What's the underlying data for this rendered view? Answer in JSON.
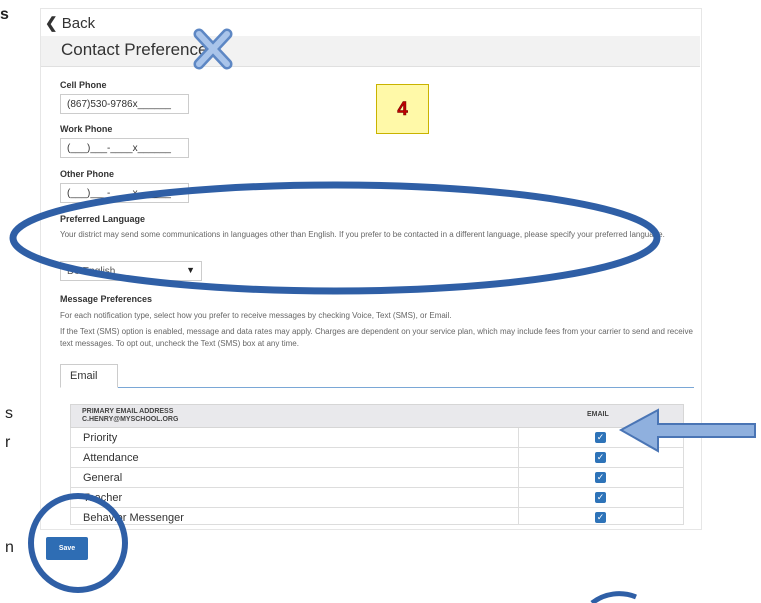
{
  "left_fragments": {
    "top": "s",
    "mid1": "s",
    "mid2": "r",
    "bottom": "n"
  },
  "nav": {
    "back_label": "Back",
    "back_icon": "chevron-left-icon"
  },
  "page": {
    "title": "Contact Preferences"
  },
  "fields": {
    "cell_phone": {
      "label": "Cell Phone",
      "value": "(867)530-9786x______"
    },
    "work_phone": {
      "label": "Work Phone",
      "value": "(___)___-____x______"
    },
    "other_phone": {
      "label": "Other Phone",
      "value": "(___)___-____x______"
    }
  },
  "preferred_language": {
    "label": "Preferred Language",
    "description": "Your district may send some communications in languages other than English. If you prefer to be contacted in a different language, please specify your preferred language.",
    "selected": "Do English"
  },
  "message_preferences": {
    "label": "Message Preferences",
    "intro": "For each notification type, select how you prefer to receive messages by checking Voice, Text (SMS), or Email.",
    "sms_note": "If the Text (SMS) option is enabled, message and data rates may apply. Charges are dependent on your service plan, which may include fees from your carrier to send and receive text messages. To opt out, uncheck the Text (SMS) box at any time."
  },
  "tabs": [
    {
      "label": "Email"
    }
  ],
  "table": {
    "header_primary": "PRIMARY EMAIL ADDRESS",
    "header_address": "C.HENRY@MYSCHOOL.ORG",
    "header_col": "EMAIL",
    "rows": [
      {
        "label": "Priority",
        "checked": true
      },
      {
        "label": "Attendance",
        "checked": true
      },
      {
        "label": "General",
        "checked": true
      },
      {
        "label": "Teacher",
        "checked": true
      },
      {
        "label": "Behavior Messenger",
        "checked": true
      }
    ]
  },
  "actions": {
    "save_label": "Save"
  },
  "annotations": {
    "step_badge": "4",
    "colors": {
      "circle": "#2f5fa6",
      "arrow_fill": "#8fb0de",
      "arrow_stroke": "#4a75b5",
      "x_mark": "#7aa3d9"
    }
  }
}
